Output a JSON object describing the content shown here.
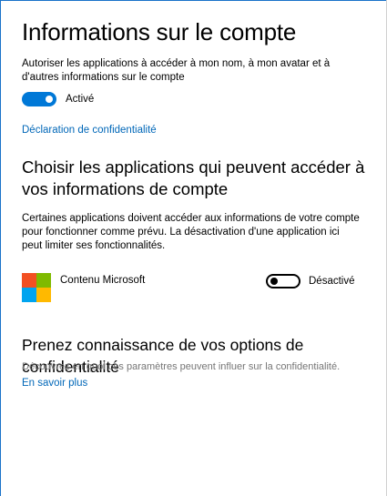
{
  "account": {
    "title": "Informations sur le compte",
    "allow_text": "Autoriser les applications à accéder à mon nom, à mon avatar et à d'autres informations sur le compte",
    "toggle_state": "Activé",
    "privacy_link": "Déclaration de confidentialité"
  },
  "apps_section": {
    "title": "Choisir les applications qui peuvent accéder à vos informations de compte",
    "description": "Certaines applications doivent accéder aux informations de votre compte pour fonctionner comme prévu. La désactivation d'une application ici peut limiter ses fonctionnalités.",
    "apps": [
      {
        "name": "Contenu Microsoft",
        "toggle_state": "Désactivé"
      }
    ]
  },
  "privacy_section": {
    "title": "Prenez connaissance de vos options de confidentialité",
    "description": "Découvrez en quoi ces paramètres peuvent influer sur la confidentialité.",
    "link": "En savoir plus"
  },
  "colors": {
    "accent": "#0078d7",
    "link": "#0067b8",
    "logo_red": "#f25022",
    "logo_green": "#7fba00",
    "logo_blue": "#00a4ef",
    "logo_yellow": "#ffb900"
  }
}
